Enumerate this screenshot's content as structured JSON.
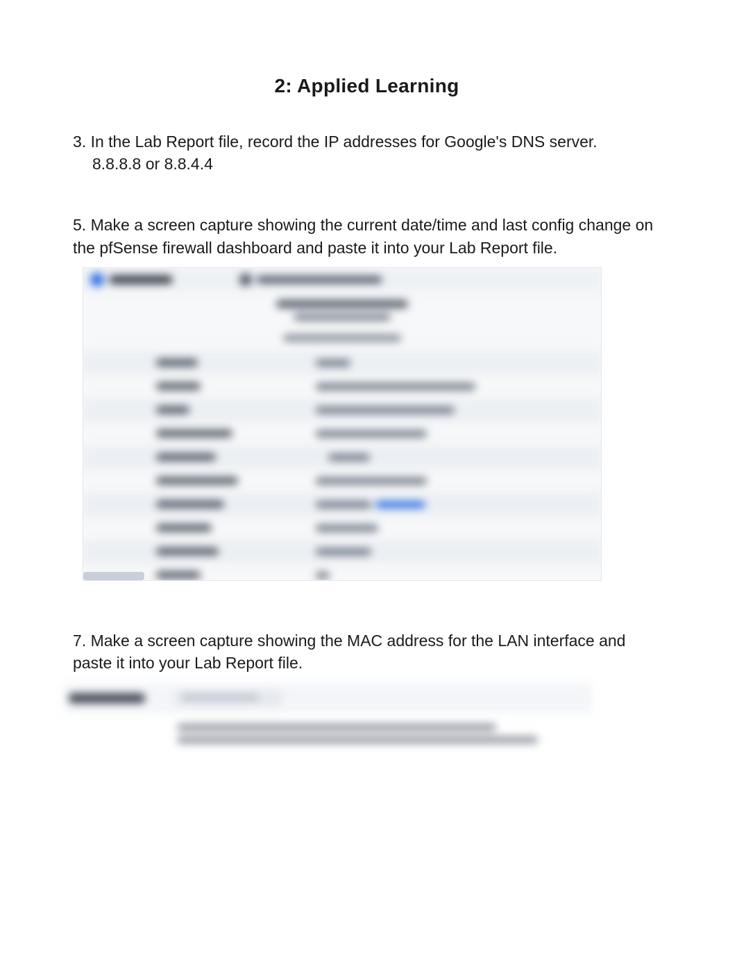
{
  "section_title": "2: Applied Learning",
  "q3": {
    "prompt": "3. In the Lab Report file, record the IP addresses for Google's DNS server.",
    "answer": "8.8.8.8 or 8.8.4.4"
  },
  "q5": {
    "prompt": "5. Make a screen capture showing the current date/time and last config change on the pfSense firewall dashboard and paste it into your Lab Report file."
  },
  "q7": {
    "prompt": "7. Make a screen capture showing the MAC address for the LAN interface and paste it into your Lab Report file."
  }
}
